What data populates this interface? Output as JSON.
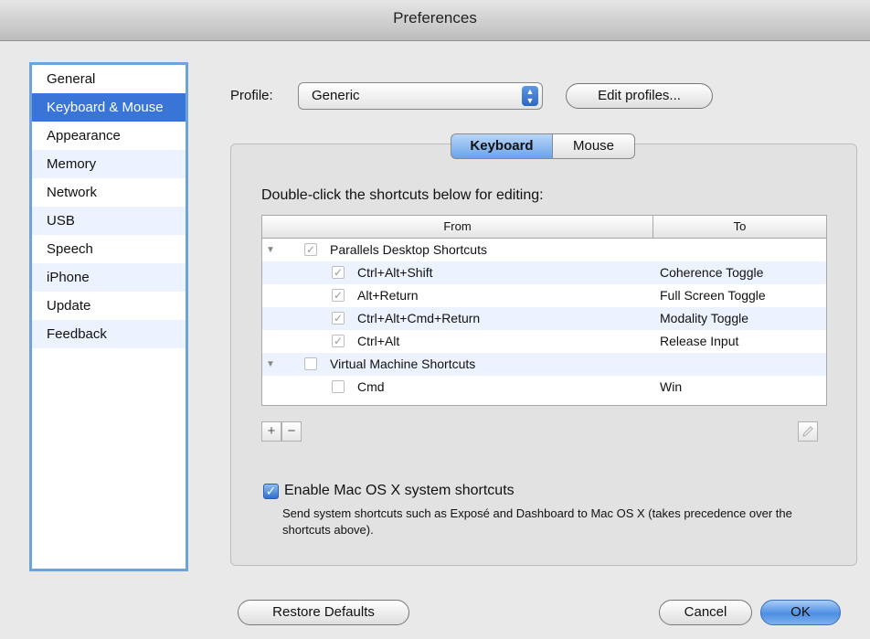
{
  "window": {
    "title": "Preferences"
  },
  "sidebar": {
    "items": [
      {
        "label": "General"
      },
      {
        "label": "Keyboard & Mouse",
        "selected": true
      },
      {
        "label": "Appearance"
      },
      {
        "label": "Memory"
      },
      {
        "label": "Network"
      },
      {
        "label": "USB"
      },
      {
        "label": "Speech"
      },
      {
        "label": "iPhone"
      },
      {
        "label": "Update"
      },
      {
        "label": "Feedback"
      }
    ]
  },
  "profile": {
    "label": "Profile:",
    "value": "Generic",
    "edit_button": "Edit profiles..."
  },
  "tabs": {
    "keyboard": "Keyboard",
    "mouse": "Mouse",
    "selected": "Keyboard"
  },
  "instructions": "Double-click the shortcuts below for editing:",
  "table": {
    "headers": {
      "from": "From",
      "to": "To"
    },
    "rows": [
      {
        "from": "Parallels Desktop Shortcuts",
        "to": "",
        "checked": true,
        "group": true
      },
      {
        "from": "Ctrl+Alt+Shift",
        "to": "Coherence Toggle",
        "checked": true
      },
      {
        "from": "Alt+Return",
        "to": "Full Screen Toggle",
        "checked": true
      },
      {
        "from": "Ctrl+Alt+Cmd+Return",
        "to": "Modality Toggle",
        "checked": true
      },
      {
        "from": "Ctrl+Alt",
        "to": "Release Input",
        "checked": true
      },
      {
        "from": "Virtual Machine Shortcuts",
        "to": "",
        "checked": false,
        "group": true
      },
      {
        "from": "Cmd",
        "to": "Win",
        "checked": false
      }
    ]
  },
  "toolbar": {
    "add": "+",
    "remove": "−"
  },
  "system_shortcuts": {
    "label": "Enable Mac OS X system shortcuts",
    "checked": true,
    "description": "Send system shortcuts such as Exposé and Dashboard to Mac OS X (takes precedence over the shortcuts above)."
  },
  "footer": {
    "restore": "Restore Defaults",
    "cancel": "Cancel",
    "ok": "OK"
  },
  "colors": {
    "selection": "#3875d7",
    "sidebar_border": "#6ea3d8",
    "default_button": "#4d8fe3"
  }
}
